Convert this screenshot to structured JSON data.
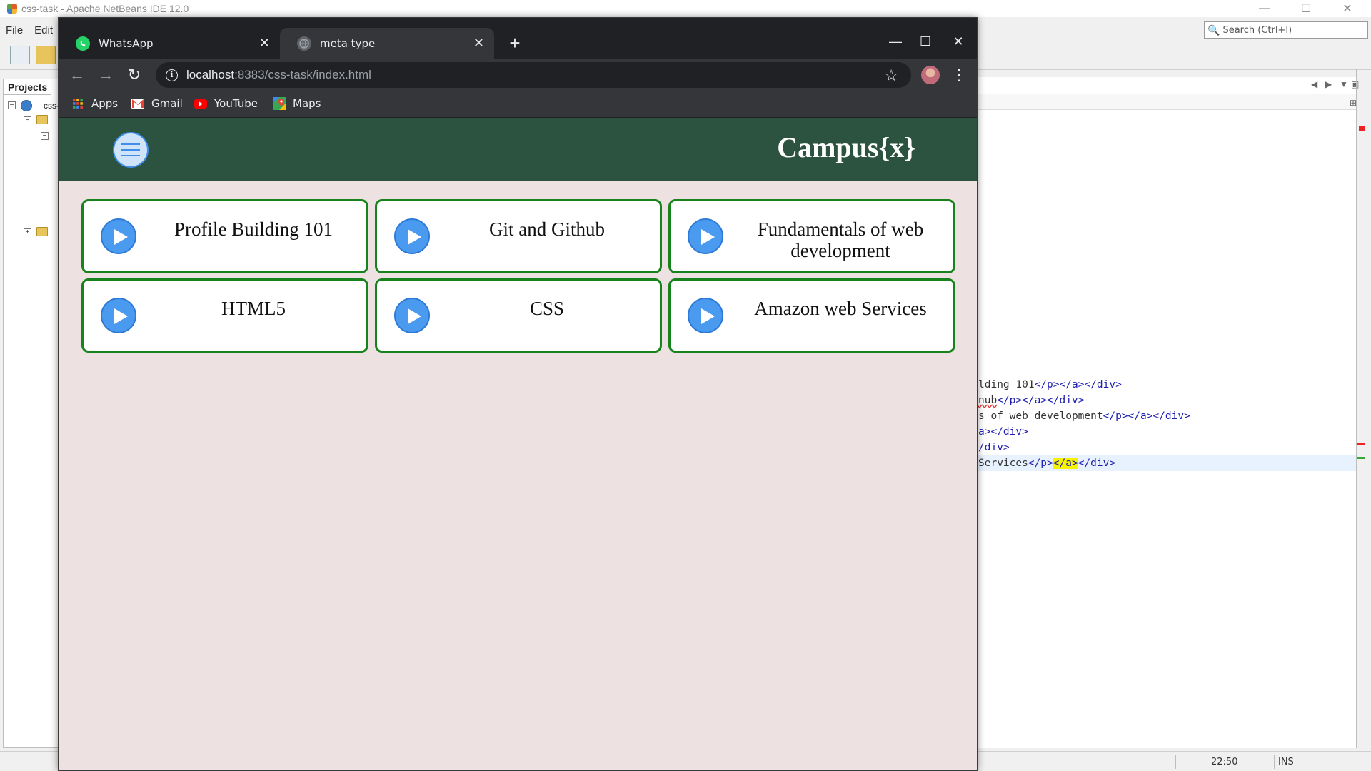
{
  "netbeans": {
    "title": "css-task - Apache NetBeans IDE 12.0",
    "menu": [
      "File",
      "Edit"
    ],
    "search_placeholder": "Search (Ctrl+I)",
    "projects_tab": "Projects",
    "project_root_label": "css-",
    "code_lines": [
      {
        "text": "lding 101",
        "tail": "</p></a></div>"
      },
      {
        "text": "nub",
        "tail": "</p></a></div>"
      },
      {
        "text": "s of web development",
        "tail": "</p></a></div>"
      },
      {
        "text": "a>",
        "tail": "</div>"
      },
      {
        "text": "/div>",
        "tail": ""
      },
      {
        "text": "Services",
        "tail": "</p>",
        "highlight": "</a>",
        "tail2": "</div>"
      }
    ],
    "status": {
      "position": "22:50",
      "mode": "INS"
    }
  },
  "chrome": {
    "tabs": [
      {
        "label": "WhatsApp",
        "icon": "whatsapp-icon",
        "active": false
      },
      {
        "label": "meta type",
        "icon": "globe-icon",
        "active": true
      }
    ],
    "url_host": "localhost",
    "url_path": ":8383/css-task/index.html",
    "bookmarks": [
      {
        "label": "Apps",
        "icon": "apps-grid-icon"
      },
      {
        "label": "Gmail",
        "icon": "gmail-icon"
      },
      {
        "label": "YouTube",
        "icon": "youtube-icon"
      },
      {
        "label": "Maps",
        "icon": "maps-icon"
      }
    ]
  },
  "site": {
    "brand": "Campus{x}",
    "courses": [
      {
        "title": "Profile Building 101"
      },
      {
        "title": "Git and Github"
      },
      {
        "title": "Fundamentals of web development"
      },
      {
        "title": "HTML5"
      },
      {
        "title": "CSS"
      },
      {
        "title": "Amazon web Services"
      }
    ]
  },
  "colors": {
    "header_bg": "#2c5340",
    "page_bg": "#eee1e1",
    "card_border": "#18821c",
    "play_button": "#4a9af0",
    "chrome_dark": "#202124",
    "chrome_toolbar": "#35363a"
  }
}
